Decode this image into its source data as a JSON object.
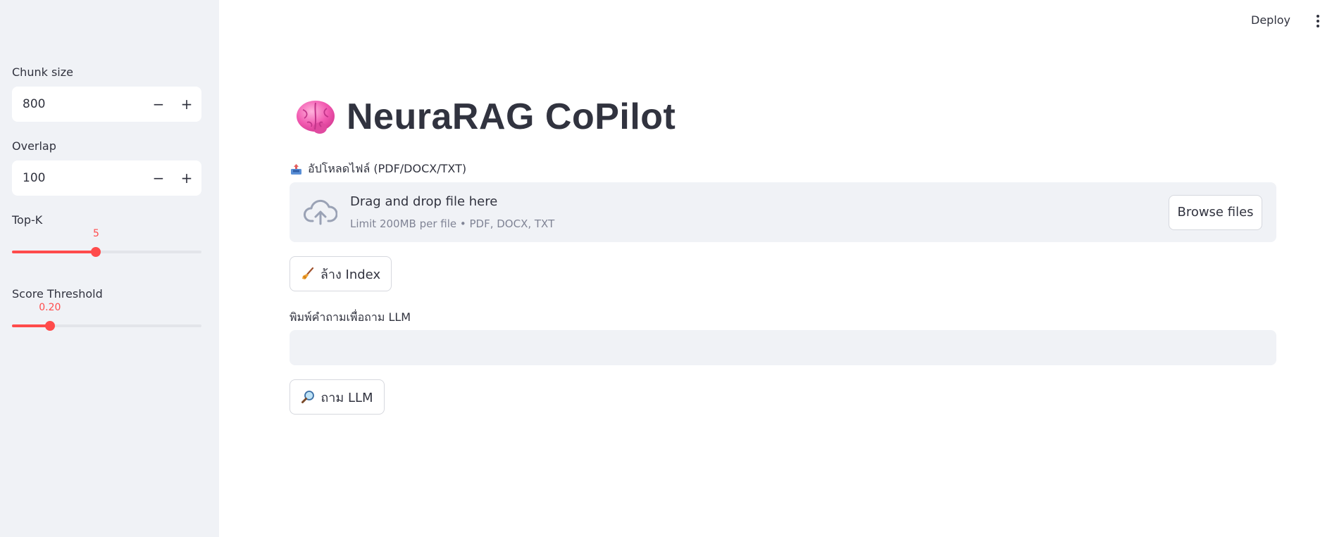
{
  "header": {
    "deploy_label": "Deploy",
    "menu_icon": "more-vertical-icon"
  },
  "sidebar": {
    "chunk_size": {
      "label": "Chunk size",
      "value": "800",
      "minus": "−",
      "plus": "+"
    },
    "overlap": {
      "label": "Overlap",
      "value": "100",
      "minus": "−",
      "plus": "+"
    },
    "top_k": {
      "label": "Top-K",
      "value": "5",
      "min": 1,
      "max": 10,
      "level": 0.444
    },
    "score_threshold": {
      "label": "Score Threshold",
      "value": "0.20",
      "min": 0.0,
      "max": 1.0,
      "level": 0.2
    }
  },
  "main": {
    "title": "NeuraRAG CoPilot",
    "title_icon": "brain-icon",
    "upload": {
      "label": "อัปโหลดไฟล์ (PDF/DOCX/TXT)",
      "label_icon": "inbox-tray-icon",
      "drop_title": "Drag and drop file here",
      "drop_hint": "Limit 200MB per file • PDF, DOCX, TXT",
      "browse_label": "Browse files"
    },
    "clear_button": {
      "label": "ล้าง Index",
      "icon": "broom-icon"
    },
    "question": {
      "label": "พิมพ์คำถามเพื่อถาม LLM",
      "value": "",
      "placeholder": ""
    },
    "ask_button": {
      "label": "ถาม LLM",
      "icon": "magnifier-icon"
    }
  },
  "colors": {
    "accent": "#ff4b4b",
    "sidebar_bg": "#f0f2f6",
    "text": "#31333f",
    "muted": "#808495"
  }
}
